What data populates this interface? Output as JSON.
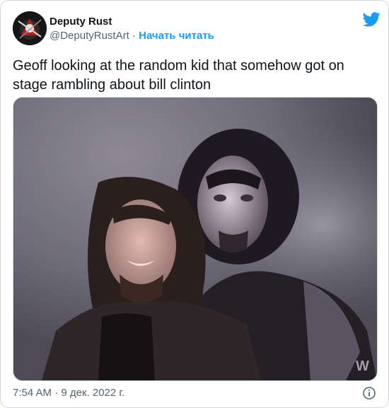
{
  "author": {
    "display_name": "Deputy Rust",
    "handle": "@DeputyRustArt",
    "separator": " · ",
    "follow_label": "Начать читать"
  },
  "tweet": {
    "text": "Geoff looking at the random kid that somehow got on stage rambling about bill clinton",
    "timestamp": "7:54 AM · 9 дек. 2022 г."
  },
  "icons": {
    "platform": "twitter-bird-icon",
    "info": "info-icon"
  },
  "colors": {
    "accent": "#1d9bf0",
    "secondary_text": "#536471",
    "primary_text": "#0f1419",
    "border": "#cfd9de"
  }
}
